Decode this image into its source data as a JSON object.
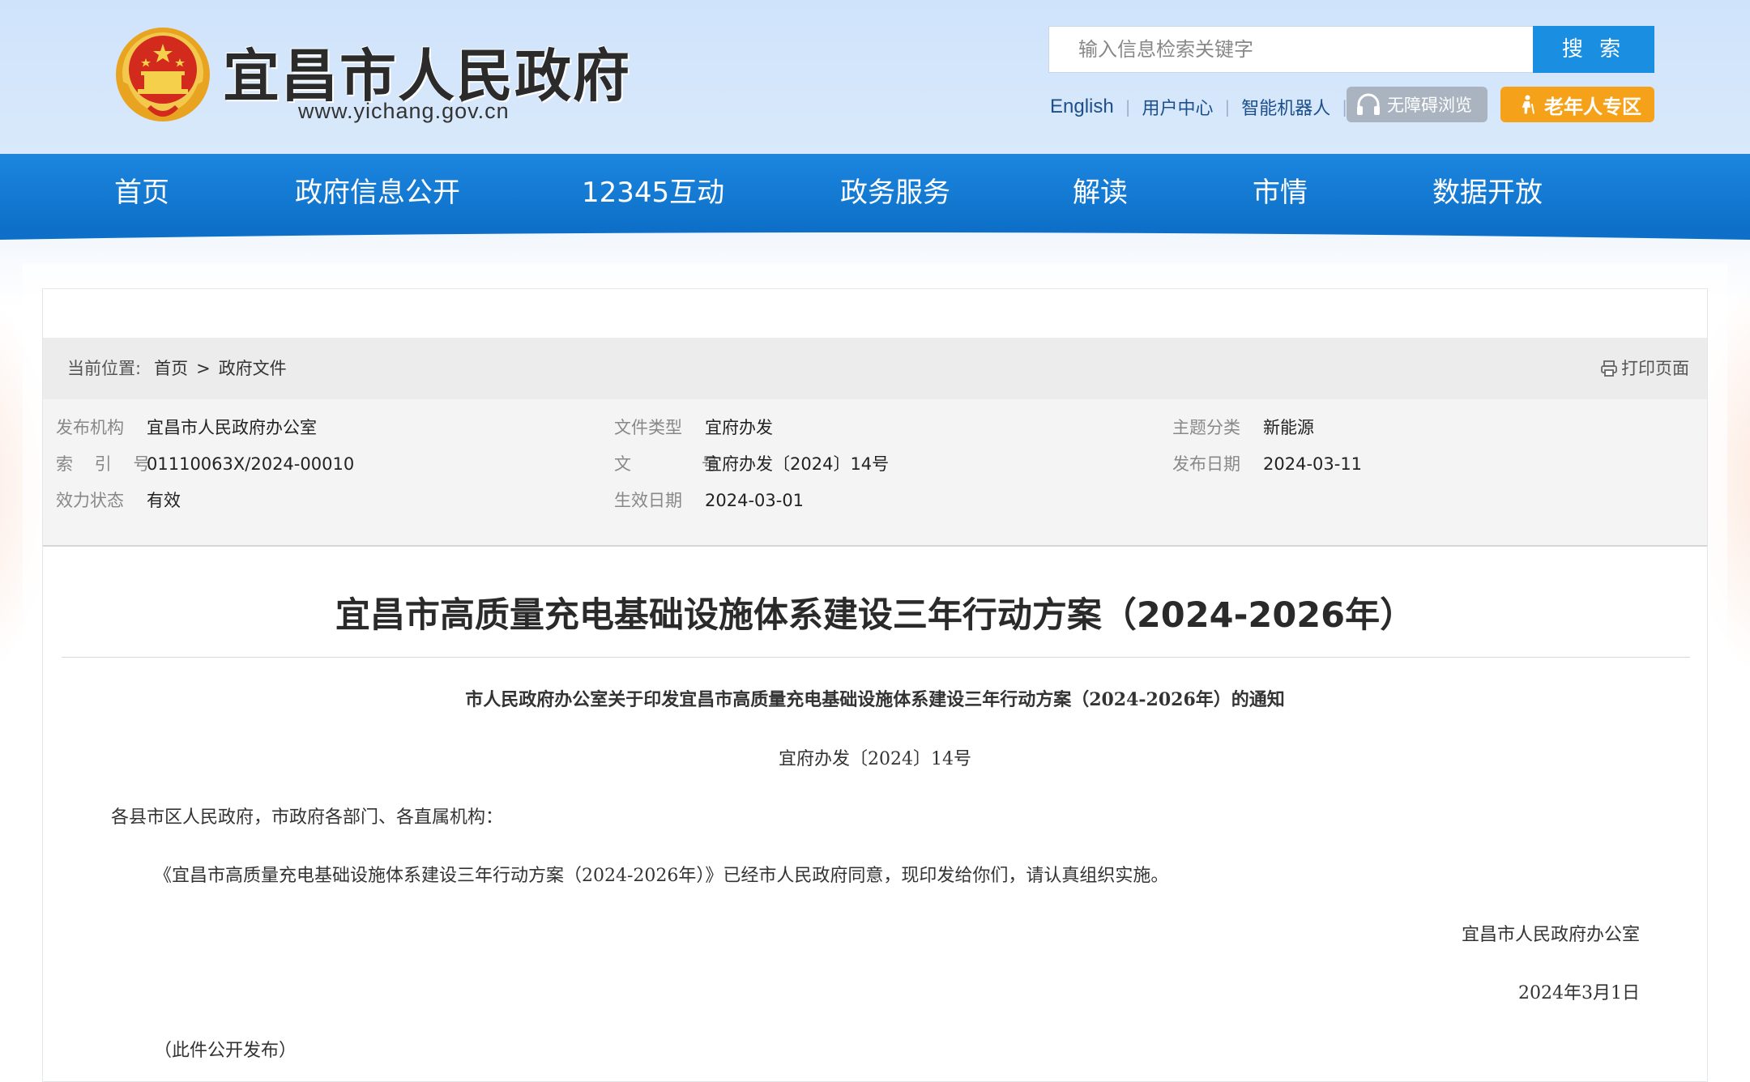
{
  "header": {
    "site_name": "宜昌市人民政府",
    "site_url": "www.yichang.gov.cn",
    "search_placeholder": "输入信息检索关键字",
    "search_button": "搜 索",
    "links": [
      "English",
      "用户中心",
      "智能机器人"
    ],
    "accessibility_button": "无障碍浏览",
    "elderly_button": "老年人专区"
  },
  "nav": {
    "items": [
      "首页",
      "政府信息公开",
      "12345互动",
      "政务服务",
      "解读",
      "市情",
      "数据开放"
    ]
  },
  "breadcrumb": {
    "label": "当前位置:",
    "items": [
      "首页",
      "政府文件"
    ],
    "separator": ">",
    "print_label": "打印页面"
  },
  "meta": {
    "publisher_key": "发布机构",
    "publisher": "宜昌市人民政府办公室",
    "index_key": "索 引 号",
    "index": "01110063X/2024-00010",
    "status_key": "效力状态",
    "status": "有效",
    "doctype_key": "文件类型",
    "doctype": "宜府办发",
    "docnum_key": "文 号",
    "docnum": "宜府办发〔2024〕14号",
    "effective_key": "生效日期",
    "effective": "2024-03-01",
    "topic_key": "主题分类",
    "topic": "新能源",
    "pubdate_key": "发布日期",
    "pubdate": "2024-03-11"
  },
  "article": {
    "title": "宜昌市高质量充电基础设施体系建设三年行动方案（2024-2026年）",
    "subtitle": "市人民政府办公室关于印发宜昌市高质量充电基础设施体系建设三年行动方案（2024-2026年）的通知",
    "doc_number": "宜府办发〔2024〕14号",
    "salutation": "各县市区人民政府，市政府各部门、各直属机构：",
    "body": "《宜昌市高质量充电基础设施体系建设三年行动方案（2024-2026年）》已经市人民政府同意，现印发给你们，请认真组织实施。",
    "signature": "宜昌市人民政府办公室",
    "date": "2024年3月1日",
    "note": "（此件公开发布）"
  },
  "colors": {
    "nav_blue": "#1a82db",
    "search_blue": "#1a8ee0",
    "elderly_orange": "#f6a11a",
    "access_gray": "#aab4c0"
  },
  "icons": [
    "national-emblem-icon",
    "headphones-icon",
    "elderly-person-icon",
    "printer-icon"
  ]
}
